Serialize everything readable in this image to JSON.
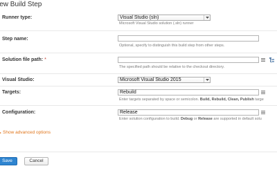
{
  "page": {
    "title": "New Build Step"
  },
  "runner": {
    "label": "Runner type:",
    "value": "Visual Studio (sln)",
    "hint": "Microsoft Visual Studio solution (.sln) runner"
  },
  "step_name": {
    "label": "Step name:",
    "value": "",
    "hint": "Optional, specify to distinguish this build step from other steps."
  },
  "solution_path": {
    "label": "Solution file path:",
    "required_mark": "*",
    "value": "",
    "hint": "The specified path should be relative to the checkout directory."
  },
  "visual_studio": {
    "label": "Visual Studio:",
    "value": "Microsoft Visual Studio 2015"
  },
  "targets": {
    "label": "Targets:",
    "value": "Rebuild",
    "hint_prefix": "Enter targets separated by space or semicolon. ",
    "hint_bold": "Build, Rebuild, Clean, Publish",
    "hint_suffix": " targe"
  },
  "configuration": {
    "label": "Configuration:",
    "value": "Release",
    "hint_prefix": "Enter solution configuration to build. ",
    "hint_bold1": "Debug",
    "hint_mid": " or ",
    "hint_bold2": "Release",
    "hint_suffix": " are supported in default solu"
  },
  "advanced": {
    "label": "Show advanced options"
  },
  "buttons": {
    "save": "Save",
    "cancel": "Cancel"
  },
  "colors": {
    "accent": "#2e84d0",
    "link": "#e0761d",
    "required": "#c0392b"
  }
}
